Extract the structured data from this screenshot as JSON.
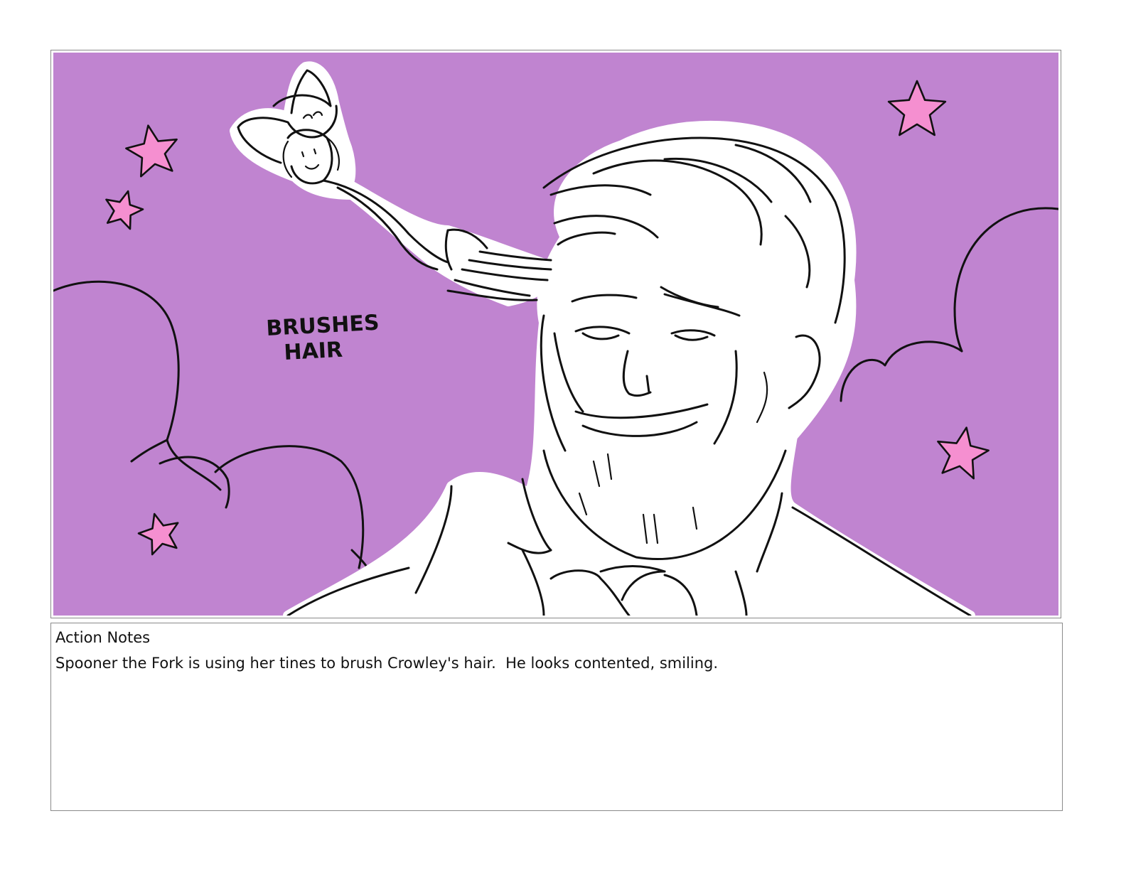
{
  "storyboard_panel": {
    "background_color": "#c084d0",
    "star_color": "#f58fd0",
    "caption_line_1": "BRUSHES",
    "caption_line_2": "HAIR"
  },
  "notes": {
    "heading": "Action Notes",
    "text": "Spooner the Fork is using her tines to brush Crowley's hair.  He looks contented, smiling."
  }
}
